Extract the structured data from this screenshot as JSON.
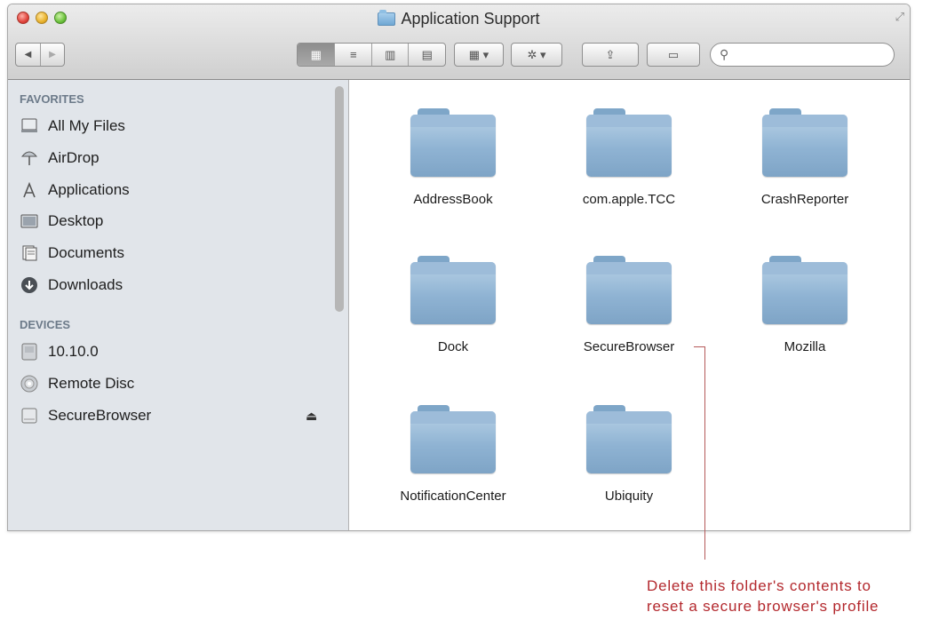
{
  "window": {
    "title": "Application Support"
  },
  "toolbar": {
    "back_glyph": "◀",
    "forward_glyph": "▶",
    "views": [
      {
        "name": "icon-view",
        "glyph": "▦",
        "active": true
      },
      {
        "name": "list-view",
        "glyph": "≡",
        "active": false
      },
      {
        "name": "column-view",
        "glyph": "▥",
        "active": false
      },
      {
        "name": "coverflow-view",
        "glyph": "▤",
        "active": false
      }
    ],
    "arrange_glyph": "▦ ▾",
    "action_glyph": "✲ ▾",
    "share_glyph": "⇪",
    "tag_glyph": "▭",
    "search_placeholder": ""
  },
  "sidebar": {
    "favorites_header": "FAVORITES",
    "favorites": [
      {
        "label": "All My Files",
        "icon": "all-my-files-icon"
      },
      {
        "label": "AirDrop",
        "icon": "airdrop-icon"
      },
      {
        "label": "Applications",
        "icon": "applications-icon"
      },
      {
        "label": "Desktop",
        "icon": "desktop-icon"
      },
      {
        "label": "Documents",
        "icon": "documents-icon"
      },
      {
        "label": "Downloads",
        "icon": "downloads-icon"
      }
    ],
    "devices_header": "DEVICES",
    "devices": [
      {
        "label": "10.10.0",
        "icon": "hard-drive-icon"
      },
      {
        "label": "Remote Disc",
        "icon": "remote-disc-icon"
      },
      {
        "label": "SecureBrowser",
        "icon": "disk-image-icon",
        "eject": "⏏"
      }
    ]
  },
  "folders": [
    {
      "label": "AddressBook"
    },
    {
      "label": "com.apple.TCC"
    },
    {
      "label": "CrashReporter"
    },
    {
      "label": "Dock"
    },
    {
      "label": "SecureBrowser"
    },
    {
      "label": "Mozilla"
    },
    {
      "label": "NotificationCenter"
    },
    {
      "label": "Ubiquity"
    }
  ],
  "annotation": {
    "line1": "Delete this folder's contents to",
    "line2": "reset a secure browser's profile"
  },
  "colors": {
    "annotation": "#b3282d",
    "sidebar_bg": "#e1e5ea",
    "folder_blue": "#8fb3d3"
  }
}
